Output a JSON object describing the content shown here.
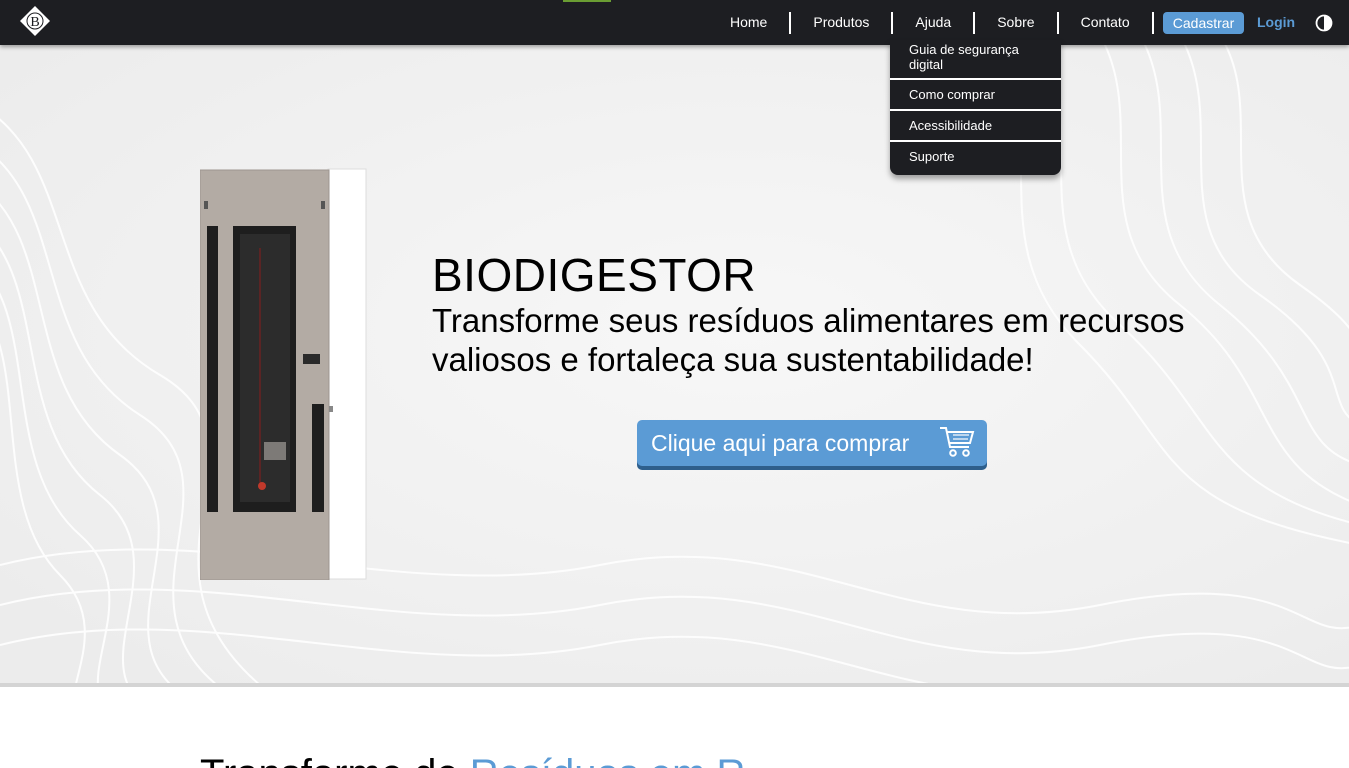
{
  "nav": {
    "items": [
      {
        "label": "Home"
      },
      {
        "label": "Produtos"
      },
      {
        "label": "Ajuda"
      },
      {
        "label": "Sobre"
      },
      {
        "label": "Contato"
      }
    ],
    "signup_label": "Cadastrar",
    "login_label": "Login",
    "logo_letter": "B",
    "contrast_icon": "contrast-icon"
  },
  "dropdown": {
    "items": [
      {
        "label": "Guia de segurança digital"
      },
      {
        "label": "Como comprar"
      },
      {
        "label": "Acessibilidade"
      },
      {
        "label": "Suporte"
      }
    ]
  },
  "hero": {
    "title": "BIODIGESTOR",
    "subtitle": "Transforme seus resíduos alimentares em recursos valiosos e fortaleça sua sustentabilidade!",
    "cta_label": "Clique aqui para comprar",
    "cta_icon": "cart-icon"
  },
  "next_section": {
    "heading_part1": "Transforme de ",
    "heading_part2": "Resíduos em R"
  },
  "colors": {
    "navbar_bg": "#1d1e22",
    "accent_blue": "#5b9bd5",
    "accent_green": "#6a9d33",
    "hero_bg": "#f4f4f4"
  }
}
